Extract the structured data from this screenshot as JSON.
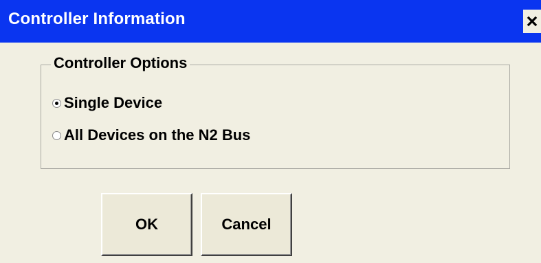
{
  "window": {
    "title": "Controller Information",
    "close_label": "×"
  },
  "group": {
    "legend": "Controller Options",
    "options": [
      {
        "label": "Single Device",
        "selected": true
      },
      {
        "label": "All Devices on the N2 Bus",
        "selected": false
      }
    ]
  },
  "buttons": {
    "ok_label": "OK",
    "cancel_label": "Cancel"
  },
  "colors": {
    "titlebar": "#0a35f0",
    "dialog_background": "#f1efe2"
  }
}
